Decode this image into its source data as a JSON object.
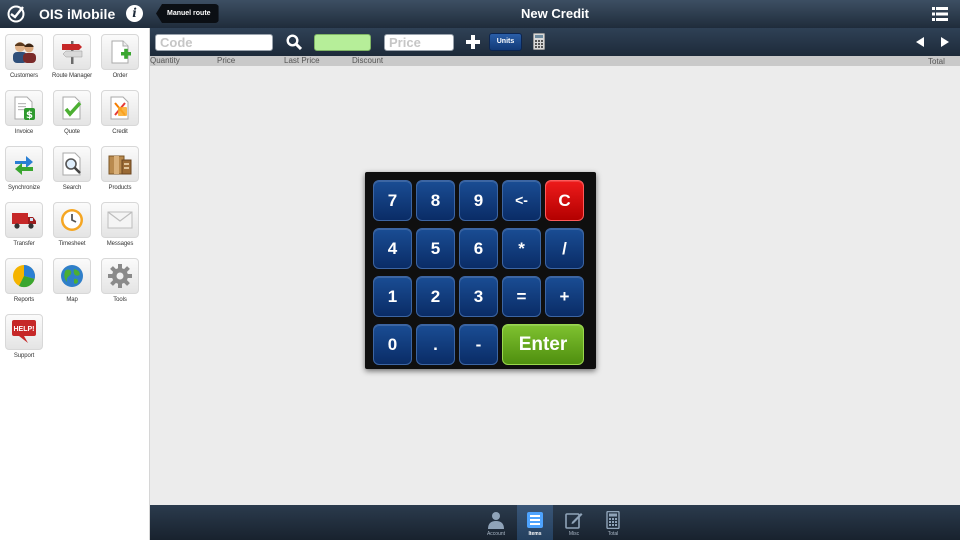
{
  "sidebar": {
    "app_title": "OIS iMobile",
    "items": [
      {
        "label": "Customers",
        "icon": "customers-icon"
      },
      {
        "label": "Route Manager",
        "icon": "route-manager-icon"
      },
      {
        "label": "Order",
        "icon": "order-icon"
      },
      {
        "label": "Invoice",
        "icon": "invoice-icon"
      },
      {
        "label": "Quote",
        "icon": "quote-icon"
      },
      {
        "label": "Credit",
        "icon": "credit-icon"
      },
      {
        "label": "Synchronize",
        "icon": "synchronize-icon"
      },
      {
        "label": "Search",
        "icon": "search-icon"
      },
      {
        "label": "Products",
        "icon": "products-icon"
      },
      {
        "label": "Transfer",
        "icon": "transfer-truck-icon"
      },
      {
        "label": "Timesheet",
        "icon": "clock-icon"
      },
      {
        "label": "Messages",
        "icon": "envelope-icon"
      },
      {
        "label": "Reports",
        "icon": "pie-chart-icon"
      },
      {
        "label": "Map",
        "icon": "globe-icon"
      },
      {
        "label": "Tools",
        "icon": "gear-icon"
      },
      {
        "label": "Support",
        "icon": "help-bubble-icon",
        "icon_text": "HELP!"
      }
    ]
  },
  "topbar": {
    "back_label": "Manuel route",
    "title": "New Credit"
  },
  "toolbar": {
    "code_placeholder": "Code",
    "quantity_value": "",
    "price_placeholder": "Price",
    "units_label": "Units"
  },
  "columns": {
    "quantity": "Quantity",
    "price": "Price",
    "last_price": "Last Price",
    "discount": "Discount",
    "total": "Total"
  },
  "keypad": {
    "keys": [
      "7",
      "8",
      "9",
      "<-",
      "C",
      "4",
      "5",
      "6",
      "*",
      "/",
      "1",
      "2",
      "3",
      "=",
      "+",
      "0",
      ".",
      "-",
      "Enter"
    ]
  },
  "bottom_tabs": [
    {
      "label": "Account",
      "icon": "person-icon",
      "active": false
    },
    {
      "label": "Items",
      "icon": "items-list-icon",
      "active": true
    },
    {
      "label": "Misc",
      "icon": "edit-icon",
      "active": false
    },
    {
      "label": "Total",
      "icon": "calculator-icon",
      "active": false
    }
  ],
  "colors": {
    "header_bg": "#2d3d4f",
    "key_blue": "#0e3a7a",
    "key_red": "#d50000",
    "key_green": "#6aa824",
    "quantity_field": "#b6ee99"
  }
}
